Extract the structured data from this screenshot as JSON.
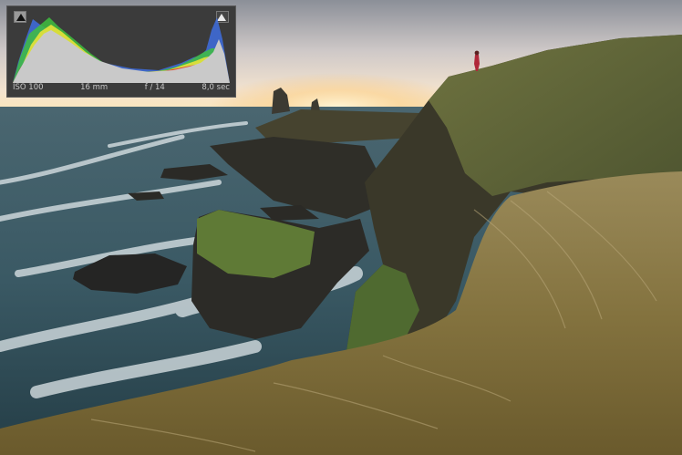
{
  "image": {
    "description_icon": "coastal-cliff-photo",
    "colors": {
      "sky": "#e9e6e2",
      "sun": "#fbe6c0",
      "sea": "#3e5a63",
      "grass": "#7b6a3e",
      "cliff": "#3c3a2c"
    }
  },
  "histogram": {
    "shadow_clip_icon": "triangle-up-icon",
    "highlight_clip_icon": "triangle-up-icon",
    "exif": {
      "iso": "ISO 100",
      "focal_length": "16 mm",
      "aperture": "f / 14",
      "shutter": "8,0 sec"
    },
    "colors": {
      "red": "#e0303a",
      "green": "#3fbf3f",
      "blue": "#3f6fe0",
      "yellow": "#e8e23a",
      "cyan": "#41c9d6",
      "magenta": "#c04ad0",
      "gray": "#c9c9c9"
    }
  }
}
